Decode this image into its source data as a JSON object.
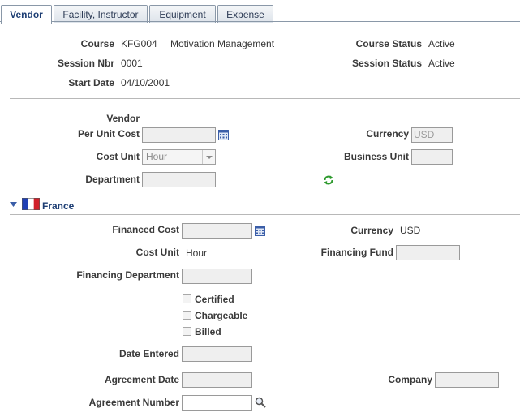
{
  "tabs": [
    {
      "label": "Vendor",
      "active": true
    },
    {
      "label": "Facility, Instructor",
      "active": false
    },
    {
      "label": "Equipment",
      "active": false
    },
    {
      "label": "Expense",
      "active": false
    }
  ],
  "header": {
    "course_label": "Course",
    "course_code": "KFG004",
    "course_name": "Motivation Management",
    "course_status_label": "Course Status",
    "course_status": "Active",
    "session_label": "Session Nbr",
    "session_nbr": "0001",
    "session_status_label": "Session Status",
    "session_status": "Active",
    "start_date_label": "Start Date",
    "start_date": "04/10/2001"
  },
  "vendor": {
    "title": "Vendor",
    "per_unit_cost_label": "Per Unit Cost",
    "currency_label": "Currency",
    "currency_value": "USD",
    "cost_unit_label": "Cost Unit",
    "cost_unit_value": "Hour",
    "business_unit_label": "Business Unit",
    "department_label": "Department"
  },
  "france": {
    "title": "France",
    "financed_cost_label": "Financed Cost",
    "currency_label": "Currency",
    "currency_value": "USD",
    "cost_unit_label": "Cost Unit",
    "cost_unit_value": "Hour",
    "financing_fund_label": "Financing Fund",
    "financing_department_label": "Financing Department",
    "certified_label": "Certified",
    "chargeable_label": "Chargeable",
    "billed_label": "Billed",
    "date_entered_label": "Date Entered",
    "agreement_date_label": "Agreement Date",
    "company_label": "Company",
    "agreement_number_label": "Agreement Number"
  },
  "colors": {
    "accent": "#1c3d73",
    "france_blue": "#1f3fb5",
    "france_red": "#d0202a",
    "refresh_green": "#2e9a2e"
  }
}
